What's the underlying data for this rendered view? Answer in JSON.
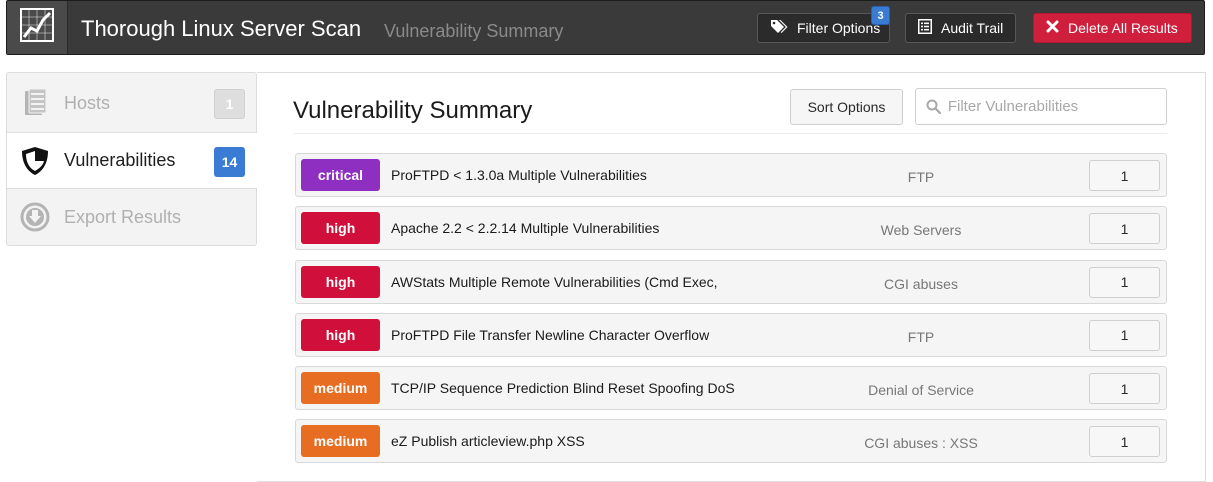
{
  "header": {
    "title": "Thorough Linux Server Scan",
    "subtitle": "Vulnerability Summary",
    "logo_icon": "chart-line-icon",
    "filter_label": "Filter Options",
    "filter_count": "3",
    "audit_label": "Audit Trail",
    "delete_label": "Delete All Results",
    "colors": {
      "bar": "#3a3a3a",
      "danger": "#d01f3c",
      "badge": "#3a7cd3"
    }
  },
  "sidebar": {
    "items": [
      {
        "label": "Hosts",
        "count": "1",
        "icon": "server-stack-icon",
        "active": false
      },
      {
        "label": "Vulnerabilities",
        "count": "14",
        "icon": "shield-icon",
        "active": true
      },
      {
        "label": "Export Results",
        "icon": "download-circle-icon",
        "active": false
      }
    ]
  },
  "main": {
    "title": "Vulnerability Summary",
    "sort_label": "Sort Options",
    "search_placeholder": "Filter Vulnerabilities",
    "rows": [
      {
        "severity": "critical",
        "name": "ProFTPD < 1.3.0a Multiple Vulnerabilities",
        "family": "FTP",
        "count": "1"
      },
      {
        "severity": "high",
        "name": "Apache 2.2 < 2.2.14 Multiple Vulnerabilities",
        "family": "Web Servers",
        "count": "1"
      },
      {
        "severity": "high",
        "name": "AWStats Multiple Remote Vulnerabilities (Cmd Exec,",
        "family": "CGI abuses",
        "count": "1"
      },
      {
        "severity": "high",
        "name": "ProFTPD File Transfer Newline Character Overflow",
        "family": "FTP",
        "count": "1"
      },
      {
        "severity": "medium",
        "name": "TCP/IP Sequence Prediction Blind Reset Spoofing DoS",
        "family": "Denial of Service",
        "count": "1"
      },
      {
        "severity": "medium",
        "name": "eZ Publish articleview.php XSS",
        "family": "CGI abuses : XSS",
        "count": "1"
      }
    ],
    "severity_colors": {
      "critical": "#8e2fc2",
      "high": "#d0103a",
      "medium": "#e66d22"
    }
  }
}
